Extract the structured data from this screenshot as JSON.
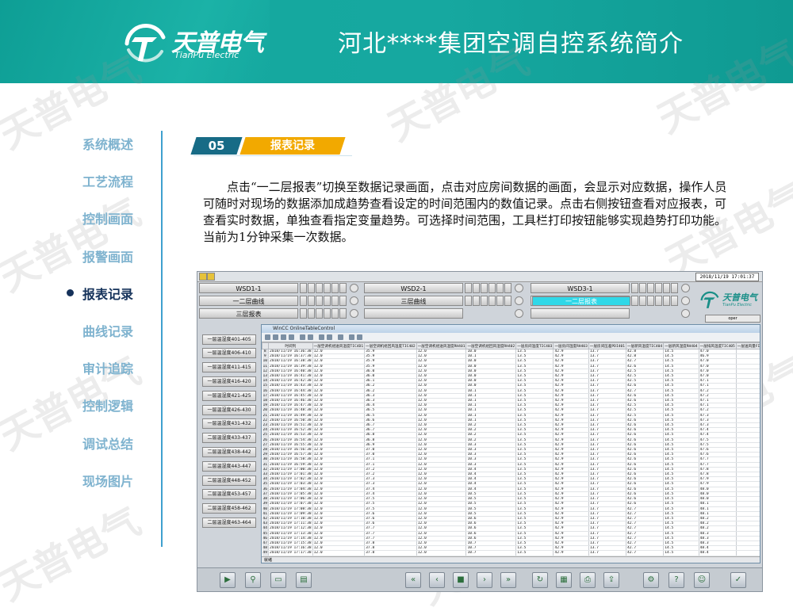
{
  "header": {
    "logo_cn": "天普电气",
    "logo_en": "TianPu Electric",
    "title": "河北****集团空调自控系统简介"
  },
  "watermark": "天普电气",
  "nav": {
    "items": [
      {
        "label": "系统概述",
        "active": false
      },
      {
        "label": "工艺流程",
        "active": false
      },
      {
        "label": "控制画面",
        "active": false
      },
      {
        "label": "报警画面",
        "active": false
      },
      {
        "label": "报表记录",
        "active": true
      },
      {
        "label": "曲线记录",
        "active": false
      },
      {
        "label": "审计追踪",
        "active": false
      },
      {
        "label": "控制逻辑",
        "active": false
      },
      {
        "label": "调试总结",
        "active": false
      },
      {
        "label": "现场图片",
        "active": false
      }
    ]
  },
  "section": {
    "number": "05",
    "title": "报表记录"
  },
  "description": "点击“一二层报表”切换至数据记录画面，点击对应房间数据的画面，会显示对应数据，操作人员可随时对现场的数据添加成趋势查看设定的时间范围内的数值记录。点击右侧按钮查看对应报表，可查看实时数据，单独查看指定变量趋势。可选择时间范围，工具栏打印按钮能够实现趋势打印功能。当前为1分钟采集一次数据。",
  "scada": {
    "datetime": "2018/11/19 17:01:37",
    "top_buttons": {
      "row1": [
        "WSD1-1",
        "WSD2-1",
        "WSD3-1"
      ],
      "row2": [
        "一二层曲线",
        "三层曲线",
        "一二层报表"
      ],
      "row3": [
        "三层报表"
      ]
    },
    "user_label": "oper",
    "logo_cn": "天普电气",
    "logo_en": "TianPu Electric",
    "room_buttons": [
      "一层温湿度401-405",
      "一层温湿度406-410",
      "一层温湿度411-415",
      "一层温湿度416-420",
      "一层温湿度421-425",
      "一层温湿度426-430",
      "一层温湿度431-432",
      "二层温湿度433-437",
      "二层温湿度438-442",
      "二层温湿度443-447",
      "二层温湿度448-452",
      "二层温湿度453-457",
      "二层温湿度458-462",
      "二层温湿度463-464"
    ],
    "window_title": "WinCC OnlineTableControl",
    "table": {
      "columns": [
        "",
        "时间列",
        "一层空调机组送风温度TIC4D1",
        "一层空调机组回风温度TIC402",
        "一层空调机组送风湿度RH401",
        "一层空调机组回风湿度RH402",
        "一层房间温度TIC403",
        "一层房间湿度RH403",
        "一层房间压差PDI401",
        "一层新风温度TIC404",
        "一层新风湿度RH404",
        "一层排风温度TIC405",
        "一层送风量FI401",
        "一层回风量FI402"
      ],
      "rows": [
        [
          "8",
          "2018/11/19 16:36:38",
          "12.0",
          "35.9",
          "12.0",
          "10.0",
          "13.5",
          "42.9",
          "13.7",
          "42.8",
          "14.5",
          "47.0"
        ],
        [
          "9",
          "2018/11/19 16:37:38",
          "12.0",
          "35.9",
          "12.0",
          "10.1",
          "13.5",
          "42.9",
          "13.7",
          "42.8",
          "14.5",
          "46.9"
        ],
        [
          "10",
          "2018/11/19 16:38:38",
          "12.0",
          "35.9",
          "12.0",
          "10.0",
          "13.5",
          "42.9",
          "13.7",
          "42.7",
          "14.5",
          "47.0"
        ],
        [
          "11",
          "2018/11/19 16:39:38",
          "12.0",
          "35.9",
          "12.0",
          "10.0",
          "13.5",
          "42.9",
          "13.7",
          "42.6",
          "14.5",
          "47.0"
        ],
        [
          "12",
          "2018/11/19 16:40:38",
          "12.0",
          "36.0",
          "12.0",
          "10.0",
          "13.5",
          "42.9",
          "13.7",
          "42.5",
          "14.5",
          "47.0"
        ],
        [
          "13",
          "2018/11/19 16:41:38",
          "12.0",
          "36.0",
          "12.0",
          "10.0",
          "13.5",
          "42.9",
          "13.7",
          "42.5",
          "14.5",
          "47.0"
        ],
        [
          "14",
          "2018/11/19 16:42:38",
          "12.0",
          "36.1",
          "12.0",
          "10.0",
          "13.5",
          "42.9",
          "13.7",
          "42.5",
          "14.5",
          "47.1"
        ],
        [
          "15",
          "2018/11/19 16:43:38",
          "12.0",
          "36.2",
          "12.0",
          "10.0",
          "13.5",
          "42.9",
          "13.7",
          "42.6",
          "14.5",
          "47.1"
        ],
        [
          "16",
          "2018/11/19 16:44:38",
          "12.0",
          "36.2",
          "12.0",
          "10.1",
          "13.5",
          "42.9",
          "13.7",
          "42.7",
          "14.5",
          "47.2"
        ],
        [
          "17",
          "2018/11/19 16:45:38",
          "12.0",
          "36.3",
          "12.0",
          "10.1",
          "13.5",
          "42.9",
          "13.7",
          "42.6",
          "14.5",
          "47.2"
        ],
        [
          "18",
          "2018/11/19 16:46:38",
          "12.0",
          "36.3",
          "12.0",
          "10.1",
          "13.5",
          "42.9",
          "13.7",
          "42.6",
          "14.5",
          "47.1"
        ],
        [
          "19",
          "2018/11/19 16:47:38",
          "12.0",
          "36.4",
          "12.0",
          "10.1",
          "13.5",
          "42.9",
          "13.7",
          "42.5",
          "14.5",
          "47.1"
        ],
        [
          "20",
          "2018/11/19 16:48:38",
          "12.0",
          "36.5",
          "12.0",
          "10.1",
          "13.5",
          "42.9",
          "13.7",
          "42.5",
          "14.5",
          "47.2"
        ],
        [
          "21",
          "2018/11/19 16:49:38",
          "12.0",
          "36.5",
          "12.0",
          "10.1",
          "13.5",
          "42.9",
          "13.7",
          "42.5",
          "14.5",
          "47.3"
        ],
        [
          "22",
          "2018/11/19 16:50:38",
          "12.0",
          "36.6",
          "12.0",
          "10.1",
          "13.5",
          "42.9",
          "13.7",
          "42.6",
          "14.5",
          "47.3"
        ],
        [
          "23",
          "2018/11/19 16:51:38",
          "12.0",
          "36.7",
          "12.0",
          "10.2",
          "13.5",
          "42.9",
          "13.7",
          "42.6",
          "14.5",
          "47.3"
        ],
        [
          "24",
          "2018/11/19 16:52:38",
          "12.0",
          "36.7",
          "12.0",
          "10.2",
          "13.5",
          "42.9",
          "13.7",
          "42.6",
          "14.5",
          "47.4"
        ],
        [
          "25",
          "2018/11/19 16:53:38",
          "12.0",
          "36.8",
          "12.0",
          "10.2",
          "13.5",
          "42.9",
          "13.7",
          "42.6",
          "14.5",
          "47.4"
        ],
        [
          "26",
          "2018/11/19 16:54:38",
          "12.0",
          "36.8",
          "12.0",
          "10.2",
          "13.5",
          "42.9",
          "13.7",
          "42.6",
          "14.5",
          "47.5"
        ],
        [
          "27",
          "2018/11/19 16:55:38",
          "12.0",
          "36.9",
          "12.0",
          "10.3",
          "13.5",
          "42.9",
          "13.7",
          "42.6",
          "14.5",
          "47.5"
        ],
        [
          "28",
          "2018/11/19 16:56:38",
          "12.0",
          "37.0",
          "12.0",
          "10.3",
          "13.5",
          "42.9",
          "13.7",
          "42.6",
          "14.5",
          "47.6"
        ],
        [
          "29",
          "2018/11/19 16:57:38",
          "12.0",
          "37.0",
          "12.0",
          "10.3",
          "13.5",
          "42.9",
          "13.7",
          "42.6",
          "14.5",
          "47.6"
        ],
        [
          "30",
          "2018/11/19 16:58:38",
          "12.0",
          "37.1",
          "12.0",
          "10.3",
          "13.5",
          "42.9",
          "13.7",
          "42.6",
          "14.5",
          "47.7"
        ],
        [
          "31",
          "2018/11/19 16:59:38",
          "12.0",
          "37.1",
          "12.0",
          "10.3",
          "13.5",
          "42.9",
          "13.7",
          "42.6",
          "14.5",
          "47.7"
        ],
        [
          "32",
          "2018/11/19 17:00:38",
          "12.0",
          "37.2",
          "12.0",
          "10.4",
          "13.5",
          "42.9",
          "13.7",
          "42.6",
          "14.5",
          "47.8"
        ],
        [
          "33",
          "2018/11/19 17:01:38",
          "12.0",
          "37.2",
          "12.0",
          "10.4",
          "13.5",
          "42.9",
          "13.7",
          "42.6",
          "14.5",
          "47.8"
        ],
        [
          "34",
          "2018/11/19 17:02:38",
          "12.0",
          "37.3",
          "12.0",
          "10.4",
          "13.5",
          "42.9",
          "13.7",
          "42.6",
          "14.5",
          "47.9"
        ],
        [
          "35",
          "2018/11/19 17:03:38",
          "12.0",
          "37.3",
          "12.0",
          "10.4",
          "13.5",
          "42.9",
          "13.7",
          "42.6",
          "14.5",
          "47.9"
        ],
        [
          "36",
          "2018/11/19 17:04:38",
          "12.0",
          "37.4",
          "12.0",
          "10.4",
          "13.5",
          "42.9",
          "13.7",
          "42.6",
          "14.5",
          "48.0"
        ],
        [
          "37",
          "2018/11/19 17:05:38",
          "12.0",
          "37.4",
          "12.0",
          "10.5",
          "13.5",
          "42.9",
          "13.7",
          "42.6",
          "14.5",
          "48.0"
        ],
        [
          "38",
          "2018/11/19 17:06:38",
          "12.0",
          "37.5",
          "12.0",
          "10.5",
          "13.5",
          "42.9",
          "13.7",
          "42.6",
          "14.5",
          "48.0"
        ],
        [
          "39",
          "2018/11/19 17:07:38",
          "12.0",
          "37.5",
          "12.0",
          "10.5",
          "13.5",
          "42.9",
          "13.7",
          "42.6",
          "14.5",
          "48.1"
        ],
        [
          "40",
          "2018/11/19 17:08:38",
          "12.0",
          "37.5",
          "12.0",
          "10.5",
          "13.5",
          "42.9",
          "13.7",
          "42.7",
          "14.5",
          "48.1"
        ],
        [
          "41",
          "2018/11/19 17:09:38",
          "12.0",
          "37.6",
          "12.0",
          "10.5",
          "13.5",
          "42.9",
          "13.7",
          "42.7",
          "14.5",
          "48.1"
        ],
        [
          "42",
          "2018/11/19 17:10:38",
          "12.0",
          "37.6",
          "12.0",
          "10.6",
          "13.5",
          "42.9",
          "13.7",
          "42.7",
          "14.5",
          "48.2"
        ],
        [
          "43",
          "2018/11/19 17:11:38",
          "12.0",
          "37.6",
          "12.0",
          "10.6",
          "13.5",
          "42.9",
          "13.7",
          "42.7",
          "14.5",
          "48.2"
        ],
        [
          "44",
          "2018/11/19 17:12:38",
          "12.0",
          "37.7",
          "12.0",
          "10.6",
          "13.5",
          "42.9",
          "13.7",
          "42.7",
          "14.5",
          "48.2"
        ],
        [
          "45",
          "2018/11/19 17:13:38",
          "12.0",
          "37.7",
          "12.0",
          "10.6",
          "13.5",
          "42.9",
          "13.7",
          "42.7",
          "14.5",
          "48.3"
        ],
        [
          "46",
          "2018/11/19 17:14:38",
          "12.0",
          "37.7",
          "12.0",
          "10.6",
          "13.5",
          "42.9",
          "13.7",
          "42.7",
          "14.5",
          "48.3"
        ],
        [
          "47",
          "2018/11/19 17:15:38",
          "12.0",
          "37.8",
          "12.0",
          "10.7",
          "13.5",
          "42.9",
          "13.7",
          "42.7",
          "14.5",
          "48.3"
        ],
        [
          "48",
          "2018/11/19 17:16:38",
          "12.0",
          "37.8",
          "12.0",
          "10.7",
          "13.5",
          "42.9",
          "13.7",
          "42.7",
          "14.5",
          "48.4"
        ],
        [
          "49",
          "2018/11/19 17:17:38",
          "12.0",
          "37.8",
          "12.0",
          "10.7",
          "13.5",
          "42.9",
          "13.7",
          "42.7",
          "14.5",
          "48.4"
        ],
        [
          "50",
          "2018/11/19 17:18:38",
          "12.0",
          "37.8",
          "12.0",
          "10.7",
          "13.5",
          "42.9",
          "13.7",
          "42.7",
          "14.5",
          "48.4"
        ],
        [
          "51",
          "2018/11/19 17:19:38",
          "12.0",
          "37.9",
          "12.0",
          "10.7",
          "13.5",
          "42.9",
          "13.7",
          "42.7",
          "14.5",
          "48.5"
        ],
        [
          "52",
          "2018/11/19 17:20:38",
          "12.0",
          "37.9",
          "12.0",
          "10.8",
          "13.5",
          "42.9",
          "13.7",
          "42.7",
          "14.5",
          "48.5"
        ],
        [
          "53",
          "2018/11/19 17:21:38",
          "12.0",
          "37.9",
          "12.0",
          "10.8",
          "13.5",
          "42.9",
          "13.7",
          "42.7",
          "14.5",
          "48.5"
        ],
        [
          "54",
          "2018/11/19 17:22:38",
          "12.0",
          "38.0",
          "12.0",
          "10.8",
          "13.5",
          "42.9",
          "13.7",
          "42.7",
          "14.5",
          "48.6"
        ],
        [
          "55",
          "2018/11/19 17:23:38",
          "12.0",
          "38.0",
          "12.0",
          "10.8",
          "13.5",
          "42.9",
          "13.7",
          "42.7",
          "14.5",
          "48.6"
        ],
        [
          "56",
          "2018/11/19 17:24:38",
          "12.0",
          "38.0",
          "12.0",
          "10.8",
          "13.5",
          "42.9",
          "13.7",
          "42.7",
          "14.5",
          "48.6"
        ],
        [
          "57",
          "2018/11/19 17:25:38",
          "12.0",
          "38.0",
          "12.0",
          "10.9",
          "13.5",
          "42.9",
          "13.7",
          "42.7",
          "14.5",
          "48.7"
        ]
      ]
    },
    "status_text": "就绪",
    "bottom_icons": [
      "play-icon",
      "filter-icon",
      "folder-icon",
      "report-icon",
      "first-icon",
      "prev-icon",
      "stop-icon",
      "next-icon",
      "last-icon",
      "refresh-icon",
      "table-icon",
      "print-icon",
      "export-icon",
      "config-icon",
      "help-icon",
      "user-icon",
      "check-icon"
    ]
  }
}
